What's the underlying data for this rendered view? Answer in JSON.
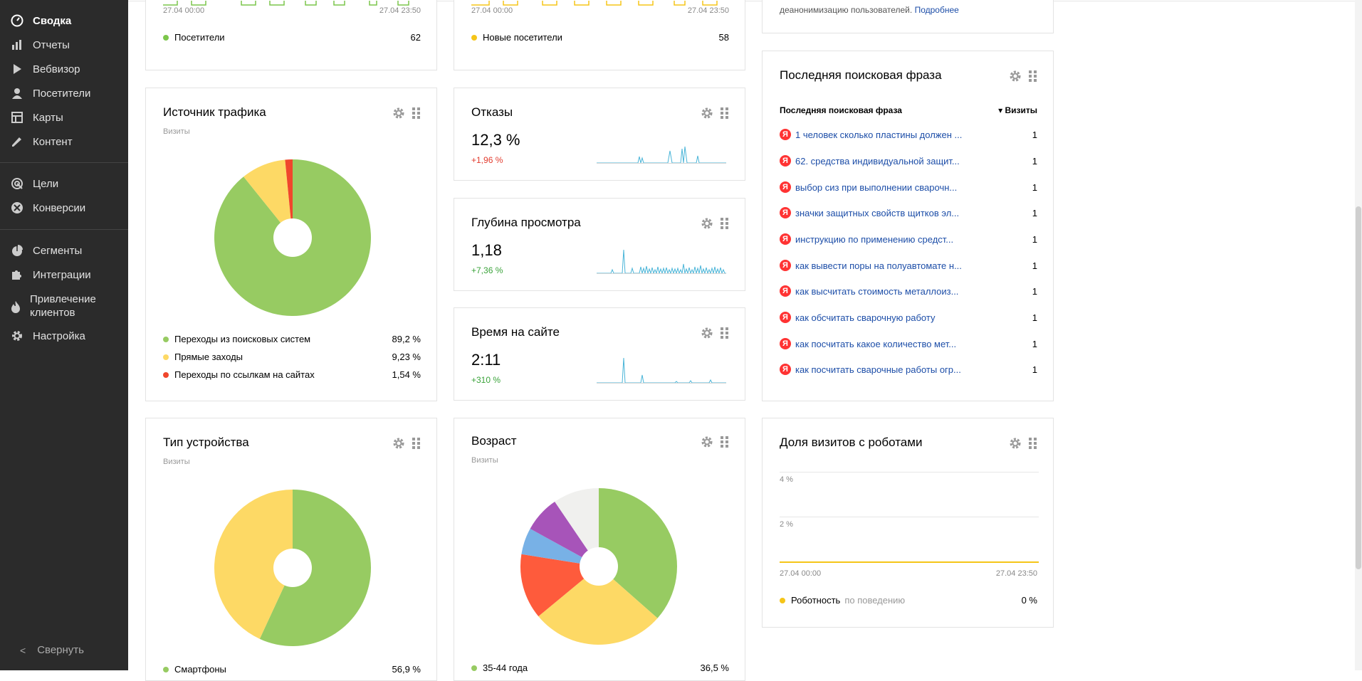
{
  "nav": {
    "items": [
      {
        "label": "Сводка",
        "icon": "gauge-icon"
      },
      {
        "label": "Отчеты",
        "icon": "bar-chart-icon"
      },
      {
        "label": "Вебвизор",
        "icon": "play-icon"
      },
      {
        "label": "Посетители",
        "icon": "user-icon"
      },
      {
        "label": "Карты",
        "icon": "map-icon"
      },
      {
        "label": "Контент",
        "icon": "pencil-icon"
      },
      {
        "label": "Цели",
        "icon": "target-icon"
      },
      {
        "label": "Конверсии",
        "icon": "conversion-icon"
      },
      {
        "label": "Сегменты",
        "icon": "pie-icon"
      },
      {
        "label": "Интеграции",
        "icon": "puzzle-icon"
      },
      {
        "label": "Привлечение клиентов",
        "icon": "fire-icon"
      },
      {
        "label": "Настройка",
        "icon": "gear-icon"
      }
    ],
    "collapse": "Свернуть"
  },
  "top_cards": {
    "visitors": {
      "from": "27.04 00:00",
      "to": "27.04 23:50",
      "legend": "Посетители",
      "value": "62",
      "color": "#7cc64b"
    },
    "new_visitors": {
      "from": "27.04 00:00",
      "to": "27.04 23:50",
      "legend": "Новые посетители",
      "value": "58",
      "color": "#f5c518"
    },
    "privacy_text": "деанонимизацию пользователей.",
    "privacy_link": "Подробнее"
  },
  "traffic": {
    "title": "Источник трафика",
    "sub": "Визиты",
    "legend": [
      {
        "label": "Переходы из поисковых систем",
        "value": "89,2 %",
        "color": "#97cb62"
      },
      {
        "label": "Прямые заходы",
        "value": "9,23 %",
        "color": "#fdd965"
      },
      {
        "label": "Переходы по ссылкам на сайтах",
        "value": "1,54 %",
        "color": "#f0462c"
      }
    ]
  },
  "bounce": {
    "title": "Отказы",
    "value": "12,3 %",
    "delta": "+1,96 %",
    "delta_color": "#e23b2e"
  },
  "depth": {
    "title": "Глубина просмотра",
    "value": "1,18",
    "delta": "+7,36 %",
    "delta_color": "#3aa33a"
  },
  "time": {
    "title": "Время на сайте",
    "value": "2:11",
    "delta": "+310 %",
    "delta_color": "#3aa33a"
  },
  "search": {
    "title": "Последняя поисковая фраза",
    "col1": "Последняя поисковая фраза",
    "col2": "▾ Визиты",
    "rows": [
      {
        "text": "1 человек сколько пластины должен ...",
        "count": "1"
      },
      {
        "text": "62. средства индивидуальной защит...",
        "count": "1"
      },
      {
        "text": "выбор сиз при выполнении сварочн...",
        "count": "1"
      },
      {
        "text": "значки защитных свойств щитков эл...",
        "count": "1"
      },
      {
        "text": "инструкцию по применению средст...",
        "count": "1"
      },
      {
        "text": "как вывести поры на полуавтомате н...",
        "count": "1"
      },
      {
        "text": "как высчитать стоимость металлоиз...",
        "count": "1"
      },
      {
        "text": "как обсчитать сварочную работу",
        "count": "1"
      },
      {
        "text": "как посчитать какое количество мет...",
        "count": "1"
      },
      {
        "text": "как посчитать сварочные работы огр...",
        "count": "1"
      }
    ]
  },
  "device": {
    "title": "Тип устройства",
    "sub": "Визиты",
    "legend": [
      {
        "label": "Смартфоны",
        "value": "56,9 %",
        "color": "#97cb62"
      }
    ]
  },
  "age": {
    "title": "Возраст",
    "sub": "Визиты",
    "legend": [
      {
        "label": "35-44 года",
        "value": "36,5 %",
        "color": "#97cb62"
      }
    ]
  },
  "robots": {
    "title": "Доля визитов с роботами",
    "y_labels": [
      "4 %",
      "2 %"
    ],
    "from": "27.04 00:00",
    "to": "27.04 23:50",
    "legend": "Роботность",
    "legend_sub": "по поведению",
    "value": "0 %",
    "color": "#f5c518"
  },
  "chart_data": [
    {
      "type": "pie",
      "title": "Источник трафика",
      "categories": [
        "Переходы из поисковых систем",
        "Прямые заходы",
        "Переходы по ссылкам на сайтах"
      ],
      "values": [
        89.2,
        9.23,
        1.54
      ],
      "colors": [
        "#97cb62",
        "#fdd965",
        "#f0462c"
      ]
    },
    {
      "type": "pie",
      "title": "Тип устройства",
      "categories": [
        "Смартфоны",
        ""
      ],
      "values": [
        56.9,
        43.1
      ],
      "colors": [
        "#97cb62",
        "#fdd965"
      ]
    },
    {
      "type": "pie",
      "title": "Возраст",
      "categories": [
        "35-44 года",
        "",
        "",
        "",
        "",
        ""
      ],
      "values": [
        36.5,
        27.5,
        13.5,
        5.5,
        7.5,
        9.5
      ],
      "colors": [
        "#97cb62",
        "#fdd965",
        "#fe5b3c",
        "#78b1e6",
        "#a754b9",
        "#f0f0ee"
      ]
    },
    {
      "type": "line",
      "title": "Доля визитов с роботами",
      "x": [
        "27.04 00:00",
        "27.04 23:50"
      ],
      "series": [
        {
          "name": "Роботность",
          "values": [
            0,
            0
          ]
        }
      ],
      "ylim": [
        0,
        4
      ]
    }
  ]
}
